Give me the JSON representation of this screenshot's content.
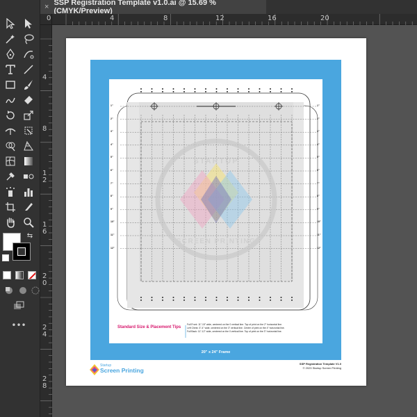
{
  "window": {
    "tab_title": "SSP Registration Template v1.0.ai @ 15.69 % (CMYK/Preview)",
    "tab_close": "×"
  },
  "rulers": {
    "horizontal": [
      "0",
      "4",
      "8",
      "12",
      "16",
      "20"
    ],
    "vertical": [
      "4",
      "8",
      "1",
      "2",
      "1",
      "6",
      "2",
      "0",
      "2",
      "4",
      "2",
      "8"
    ]
  },
  "toolbar": {
    "tools": [
      "selection-tool",
      "direct-selection-tool",
      "magic-wand-tool",
      "lasso-tool",
      "pen-tool",
      "curvature-tool",
      "type-tool",
      "line-segment-tool",
      "rectangle-tool",
      "paintbrush-tool",
      "shaper-tool",
      "eraser-tool",
      "rotate-tool",
      "scale-tool",
      "width-tool",
      "free-transform-tool",
      "shape-builder-tool",
      "perspective-grid-tool",
      "mesh-tool",
      "gradient-tool",
      "eyedropper-tool",
      "blend-tool",
      "symbol-sprayer-tool",
      "column-graph-tool",
      "artboard-tool",
      "slice-tool",
      "hand-tool",
      "zoom-tool"
    ],
    "more": "•••"
  },
  "document": {
    "tips_title": "Standard Size & Placement Tips",
    "tips": [
      "Full Front: 11\"-15\" wide, centered on the 0 vertical line. Top of print on the 2\" horizontal line.",
      "Left Chest: 3\"-4\" wide, centered on the 3\" vertical line. Center of print on the 4\" horizontal line.",
      "Full Back: 11\"-12\" wide, centered on the 0 vertical line. Top of print on the 3\" horizontal line."
    ],
    "frame_label": "20\" x 24\" Frame",
    "logo_small": "Startup",
    "logo_main": "Screen Printing",
    "footer_line1": "SSP Registration Template V1.0",
    "footer_line2": "© 2023 Startup Screen Printing",
    "watermark_top": "STARTUP",
    "watermark_bottom": "SCREEN PRINTING",
    "row_labels_left": [
      "1\"",
      "2\"",
      "3\"",
      "4\"",
      "5\"",
      "6\"",
      "7\"",
      "8\"",
      "9\"",
      "10\"",
      "11\"",
      "12\""
    ],
    "row_labels_right": [
      "1\"",
      "2\"",
      "3\"",
      "4\"",
      "5\"",
      "6\"",
      "7\"",
      "8\"",
      "9\"",
      "10\"",
      "11\"",
      "12\""
    ]
  },
  "colors": {
    "frame_blue": "#4aa6df",
    "tips_pink": "#d6156b",
    "platen_gray": "#e6e6e6"
  }
}
